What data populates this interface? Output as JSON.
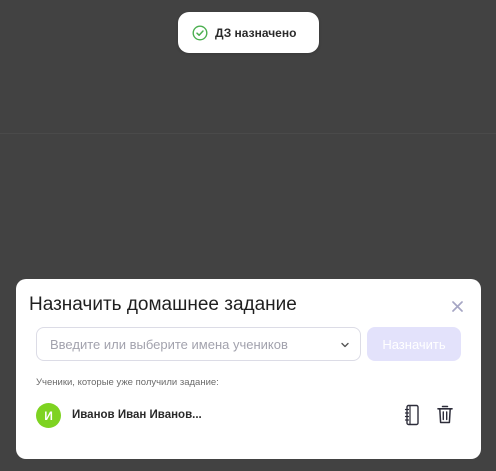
{
  "toast": {
    "text": "ДЗ назначено",
    "icon": "check-circle-icon",
    "color": "#4caf50"
  },
  "modal": {
    "title": "Назначить домашнее задание",
    "close_icon": "close-icon",
    "students_select": {
      "placeholder": "Введите или выберите имена учеников",
      "value": ""
    },
    "assign_button_label": "Назначить",
    "received_label": "Ученики, которые уже получили задание:",
    "students": [
      {
        "initial": "И",
        "name": "Иванов Иван Иванов...",
        "avatar_color": "#7ed321"
      }
    ]
  },
  "colors": {
    "backdrop": "#424242",
    "accent_disabled": "#e3e2fb"
  }
}
